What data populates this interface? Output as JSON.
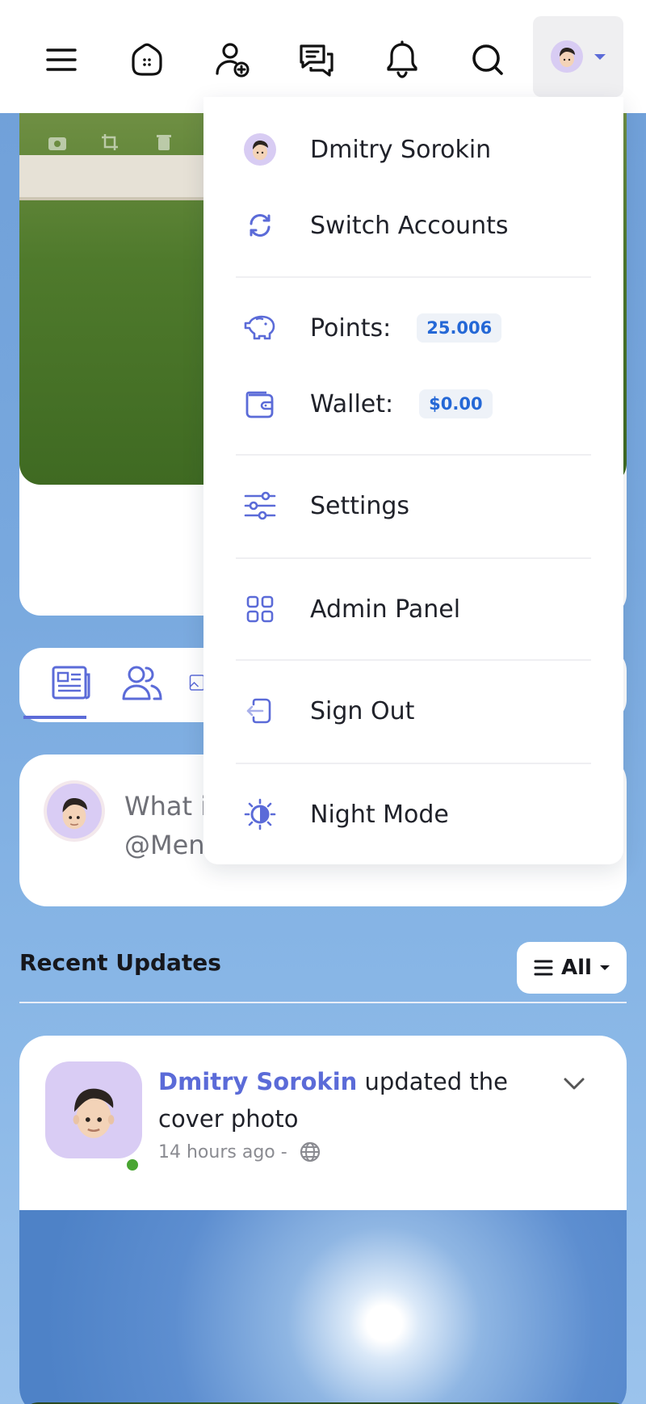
{
  "user": {
    "name": "Dmitry Sorokin"
  },
  "menu": {
    "switch_accounts": "Switch Accounts",
    "points_label": "Points:",
    "points_value": "25.006",
    "wallet_label": "Wallet:",
    "wallet_value": "$0.00",
    "settings": "Settings",
    "admin_panel": "Admin Panel",
    "sign_out": "Sign Out",
    "night_mode": "Night Mode"
  },
  "composer": {
    "placeholder_line1": "What i",
    "placeholder_line2": "@Men"
  },
  "recent": {
    "title": "Recent Updates",
    "filter_label": "All"
  },
  "post": {
    "author": "Dmitry Sorokin",
    "action": " updated the cover photo",
    "time": "14 hours ago -"
  },
  "colors": {
    "accent": "#5b6bd8",
    "badge_text": "#2568d6",
    "online": "#49a532"
  },
  "icons": [
    "menu-icon",
    "home-icon",
    "add-friend-icon",
    "messages-icon",
    "bell-icon",
    "search-icon",
    "switch-icon",
    "piggy-bank-icon",
    "wallet-icon",
    "sliders-icon",
    "grid-icon",
    "sign-out-icon",
    "night-mode-icon"
  ]
}
